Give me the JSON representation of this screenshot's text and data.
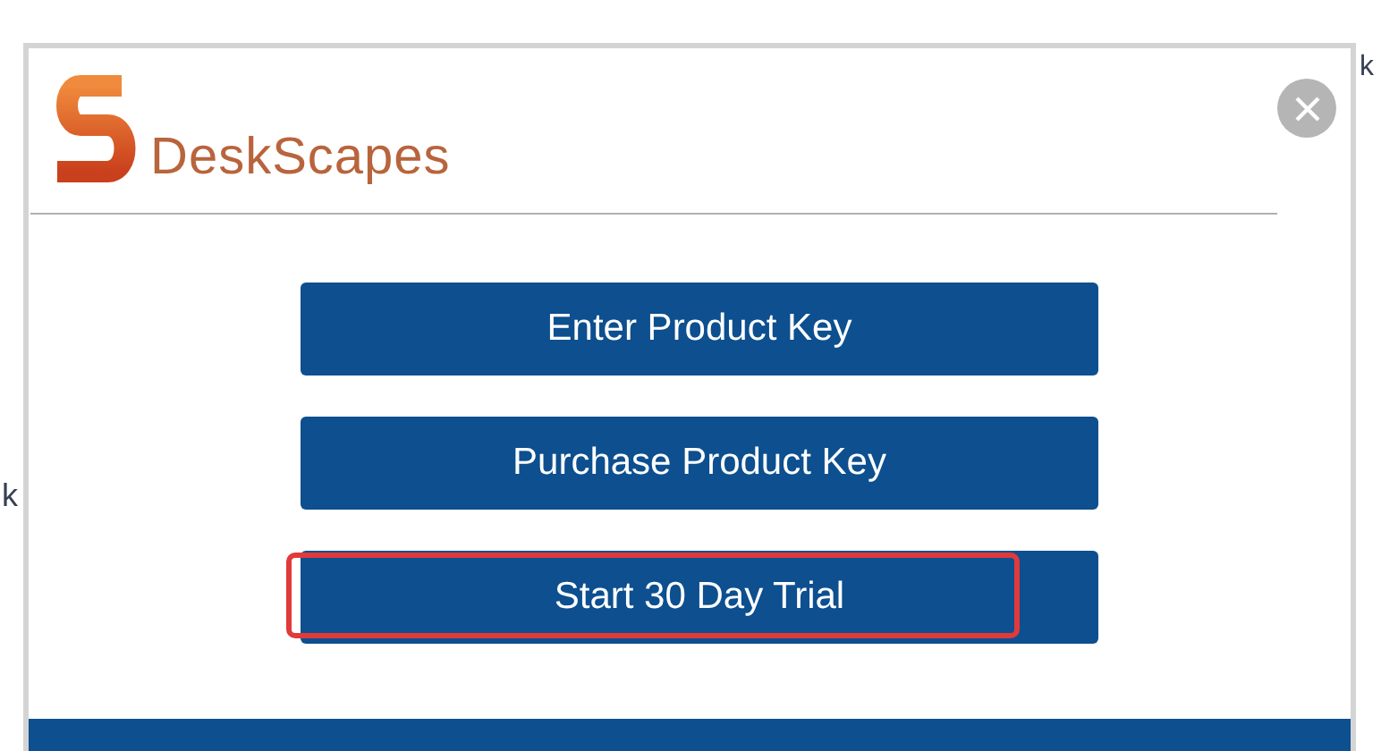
{
  "background_text": [
    "k",
    "k"
  ],
  "dialog": {
    "logo": {
      "text": "DeskScapes"
    },
    "buttons": [
      {
        "label": "Enter Product Key",
        "highlighted": false
      },
      {
        "label": "Purchase Product Key",
        "highlighted": false
      },
      {
        "label": "Start 30 Day Trial",
        "highlighted": true
      }
    ]
  }
}
